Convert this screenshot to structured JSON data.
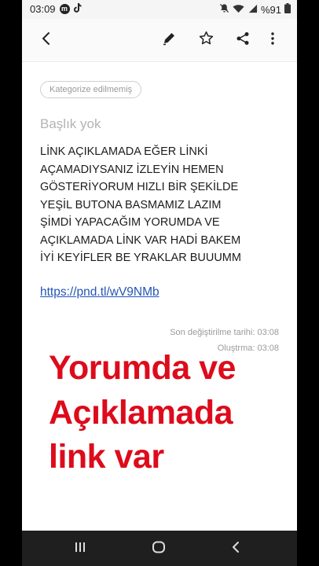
{
  "status_bar": {
    "time": "03:09",
    "battery": "%91",
    "app_badge": "m"
  },
  "toolbar": {
    "back_icon": "back-arrow-icon",
    "edit_icon": "pencil-icon",
    "favorite_icon": "star-outline-icon",
    "share_icon": "share-icon",
    "more_icon": "more-vertical-icon"
  },
  "note": {
    "category": "Kategorize edilmemiş",
    "title": "Başlık yok",
    "body_lines": [
      "LİNK AÇIKLAMADA EĞER LİNKİ",
      "AÇAMADIYSANIZ İZLEYİN HEMEN",
      "GÖSTERİYORUM HIZLI BİR ŞEKİLDE",
      "YEŞİL BUTONA BASMAMIZ LAZIM",
      "ŞİMDİ YAPACAĞIM YORUMDA VE",
      "AÇIKLAMADA LİNK VAR HADİ BAKEM",
      "İYİ KEYİFLER BE YRAKLAR BUUUMM"
    ],
    "link": "https://pnd.tl/wV9NMb",
    "modified": "Son değiştirilme tarihi: 03:08",
    "created": "Oluştrma: 03:08"
  },
  "overlay_text": [
    "Yorumda ve",
    "Açıklamada",
    "link var"
  ],
  "colors": {
    "overlay": "#dd0b1b",
    "link": "#2355b8",
    "nav_bar": "#1f1f1f"
  },
  "nav": {
    "recents_icon": "recents-icon",
    "home_icon": "home-icon",
    "back_icon": "nav-back-icon"
  }
}
